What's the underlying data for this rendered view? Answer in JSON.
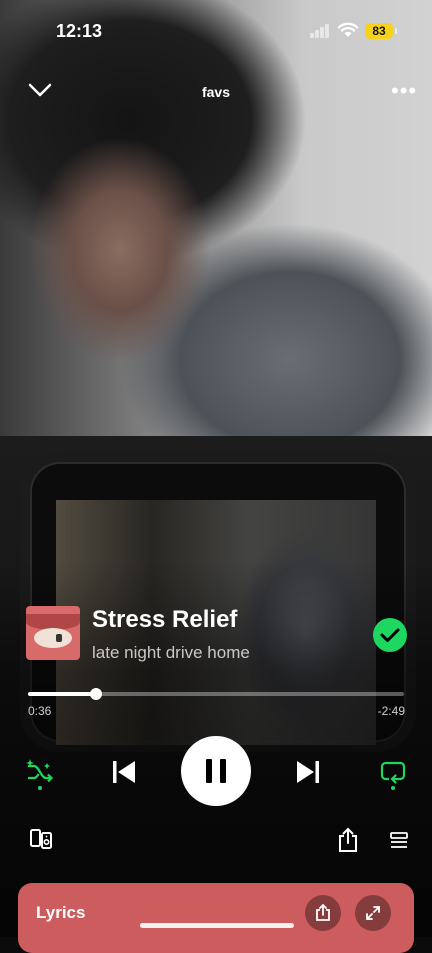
{
  "status_bar": {
    "time": "12:13",
    "battery": "83"
  },
  "header": {
    "title": "favs"
  },
  "track": {
    "title": "Stress Relief",
    "subtitle": "late night drive home"
  },
  "progress": {
    "elapsed": "0:36",
    "remaining": "-2:49",
    "fraction": 0.18
  },
  "lyrics": {
    "label": "Lyrics"
  },
  "icons": {
    "collapse": "chevron-down-icon",
    "more": "more-horizontal-icon",
    "saved": "check-circle-icon",
    "shuffle": "smart-shuffle-icon",
    "previous": "skip-previous-icon",
    "pause": "pause-icon",
    "next": "skip-next-icon",
    "repeat": "repeat-icon",
    "devices": "connect-device-icon",
    "share": "share-icon",
    "queue": "queue-icon",
    "expand": "expand-icon"
  },
  "colors": {
    "accent": "#1ed760",
    "lyrics_bg": "#cd5c5e",
    "battery": "#f7d21b"
  }
}
